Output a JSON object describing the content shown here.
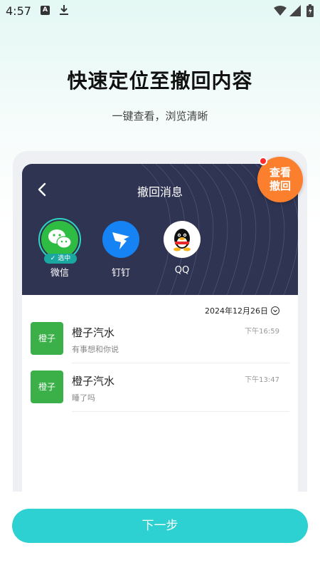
{
  "status_bar": {
    "time": "4:57",
    "notif_a": "A"
  },
  "hero": {
    "title": "快速定位至撤回内容",
    "subtitle": "一键查看，浏览清晰"
  },
  "screen": {
    "title": "撤回消息",
    "apps": [
      {
        "name": "微信",
        "badge": "✓ 选中",
        "color": "#2fbc43"
      },
      {
        "name": "钉钉",
        "color": "#1683f5"
      },
      {
        "name": "QQ",
        "color": "#ffffff"
      }
    ],
    "date": "2024年12月26日",
    "messages": [
      {
        "avatar": "橙子",
        "name": "橙子汽水",
        "preview": "有事想和你说",
        "time": "下午16:59"
      },
      {
        "avatar": "橙子",
        "name": "橙子汽水",
        "preview": "睡了吗",
        "time": "下午13:47"
      }
    ]
  },
  "badge": {
    "line1": "查看",
    "line2": "撤回"
  },
  "next_button": {
    "label": "下一步"
  },
  "colors": {
    "accent": "#2dd1d1",
    "header_bg": "#2f3452",
    "badge_orange": "#fb7f2d",
    "avatar_green": "#3bb049"
  }
}
